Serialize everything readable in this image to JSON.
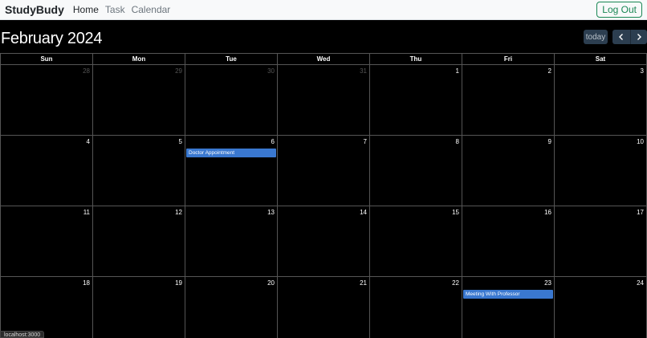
{
  "navbar": {
    "brand": "StudyBudy",
    "links": [
      {
        "label": "Home",
        "active": true
      },
      {
        "label": "Task",
        "active": false
      },
      {
        "label": "Calendar",
        "active": false
      }
    ],
    "logout_label": "Log Out"
  },
  "calendar": {
    "title": "February 2024",
    "today_label": "today",
    "prev_icon": "chevron-left-icon",
    "next_icon": "chevron-right-icon",
    "weekdays": [
      "Sun",
      "Mon",
      "Tue",
      "Wed",
      "Thu",
      "Fri",
      "Sat"
    ],
    "weeks": [
      [
        {
          "num": "28",
          "other": true
        },
        {
          "num": "29",
          "other": true
        },
        {
          "num": "30",
          "other": true
        },
        {
          "num": "31",
          "other": true
        },
        {
          "num": "1"
        },
        {
          "num": "2"
        },
        {
          "num": "3"
        }
      ],
      [
        {
          "num": "4"
        },
        {
          "num": "5"
        },
        {
          "num": "6",
          "event": "Doctor Appointment"
        },
        {
          "num": "7"
        },
        {
          "num": "8"
        },
        {
          "num": "9"
        },
        {
          "num": "10"
        }
      ],
      [
        {
          "num": "11"
        },
        {
          "num": "12"
        },
        {
          "num": "13"
        },
        {
          "num": "14"
        },
        {
          "num": "15"
        },
        {
          "num": "16"
        },
        {
          "num": "17"
        }
      ],
      [
        {
          "num": "18"
        },
        {
          "num": "19"
        },
        {
          "num": "20"
        },
        {
          "num": "21"
        },
        {
          "num": "22"
        },
        {
          "num": "23",
          "event": "Meeting With Professor"
        },
        {
          "num": "24"
        }
      ]
    ],
    "event_color": "#3a78d0"
  },
  "status_bar": {
    "url": "localhost:3000"
  }
}
